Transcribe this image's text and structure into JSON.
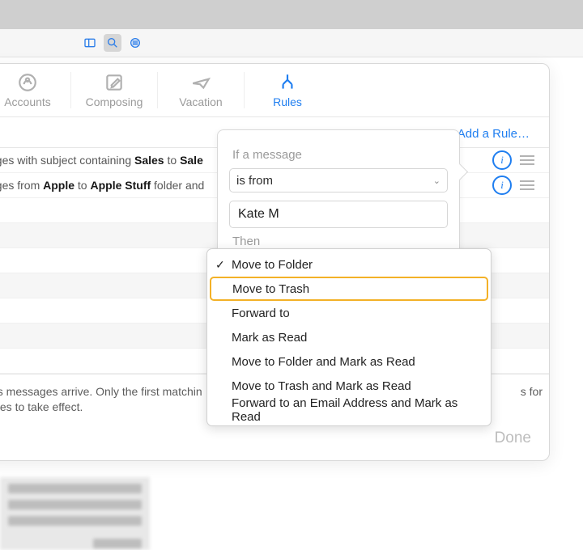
{
  "toolbar": {
    "icons": [
      "sidebar-icon",
      "search-icon",
      "list-icon"
    ]
  },
  "tabs": {
    "accounts": "Accounts",
    "composing": "Composing",
    "vacation": "Vacation",
    "rules": "Rules"
  },
  "rules": {
    "add_label": "Add a Rule…",
    "row1_prefix": "ages with subject containing ",
    "row1_bold1": "Sales",
    "row1_mid": " to ",
    "row1_bold2": "Sale",
    "row2_prefix": "ages from ",
    "row2_bold1": "Apple",
    "row2_mid": " to ",
    "row2_bold2": "Apple Stuff",
    "row2_suffix": " folder and",
    "footer_line1": " as messages arrive. Only the first matchin",
    "footer_tail": "s for",
    "footer_line2": "ules to take effect.",
    "done": "Done"
  },
  "popover": {
    "if_label": "If a message",
    "condition": "is from",
    "value": "Kate M",
    "then_label": "Then"
  },
  "menu": {
    "items": [
      "Move to Folder",
      "Move to Trash",
      "Forward to",
      "Mark as Read",
      "Move to Folder and Mark as Read",
      "Move to Trash and Mark as Read",
      "Forward to an Email Address and Mark as Read"
    ]
  }
}
